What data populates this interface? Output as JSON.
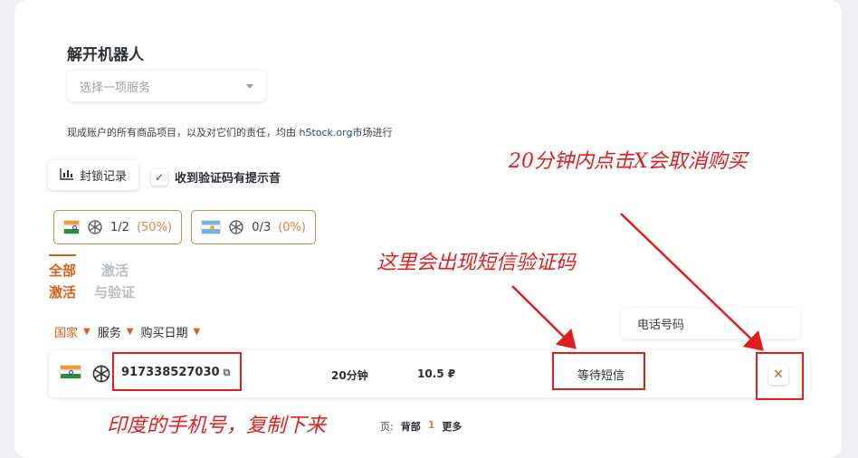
{
  "page": {
    "title": "解开机器人",
    "service_select": {
      "placeholder": "选择一项服务"
    },
    "notice_prefix": "现成账户的所有商品项目，以及对它们的责任，均由 ",
    "notice_link": "hStock.org",
    "notice_suffix": "市场进行"
  },
  "toolbar": {
    "log_button": "封锁记录",
    "sound_checkbox_label": "收到验证码有提示音",
    "sound_checkbox_checked": true
  },
  "country_chips": [
    {
      "flag": "india-flag-icon",
      "count": "1/2",
      "percent": "(50%)"
    },
    {
      "flag": "argentina-flag-icon",
      "count": "0/3",
      "percent": "(0%)"
    }
  ],
  "tabs": [
    {
      "label_line1": "全部",
      "label_line2": "激活",
      "active": true
    },
    {
      "label_line1": "激活",
      "label_line2": "与验证",
      "active": false
    }
  ],
  "filters": [
    "国家",
    "服务",
    "购买日期"
  ],
  "phone_column_label": "电话号码",
  "order": {
    "flag": "india-flag-icon",
    "service_icon": "openai-icon",
    "phone": "917338527030",
    "duration": "20分钟",
    "price": "10.5 ₽",
    "status": "等待短信"
  },
  "pager": {
    "prefix": "页:",
    "first": "背部",
    "current": "1",
    "more": "更多"
  },
  "annotations": {
    "cancel_hint": "20分钟内点击X会取消购买",
    "sms_hint": "这里会出现短信验证码",
    "phone_hint": "印度的手机号，复制下来"
  },
  "colors": {
    "accent": "#d8601a",
    "chip_border": "#d8853f",
    "annotation": "#e01e1e"
  }
}
